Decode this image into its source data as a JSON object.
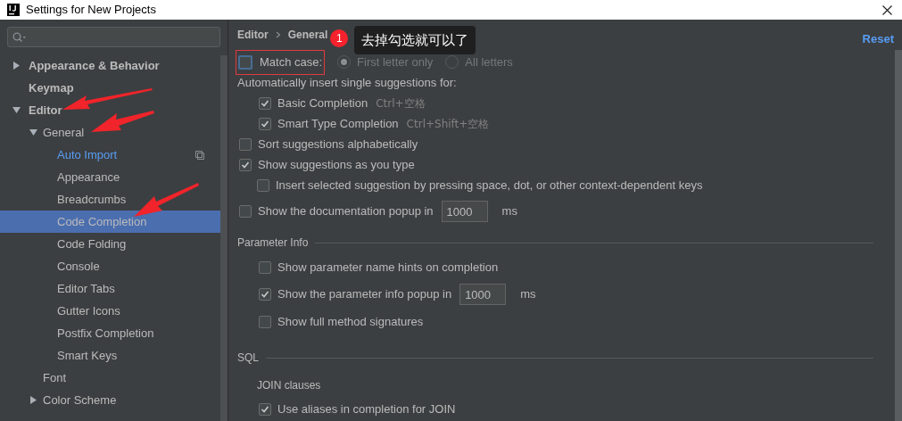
{
  "window": {
    "title": "Settings for New Projects"
  },
  "sidebar": {
    "tree": [
      {
        "label": "Appearance & Behavior",
        "expanded": false,
        "selected": false
      },
      {
        "label": "Keymap",
        "selected": false
      },
      {
        "label": "Editor",
        "expanded": true,
        "selected": false,
        "children": [
          {
            "label": "General",
            "expanded": true,
            "selected": false,
            "children": [
              {
                "label": "Auto Import",
                "selected": false,
                "modified": true,
                "project_level": true
              },
              {
                "label": "Appearance",
                "selected": false
              },
              {
                "label": "Breadcrumbs",
                "selected": false
              },
              {
                "label": "Code Completion",
                "selected": true
              },
              {
                "label": "Code Folding",
                "selected": false
              },
              {
                "label": "Console",
                "selected": false
              },
              {
                "label": "Editor Tabs",
                "selected": false
              },
              {
                "label": "Gutter Icons",
                "selected": false
              },
              {
                "label": "Postfix Completion",
                "selected": false
              },
              {
                "label": "Smart Keys",
                "selected": false
              }
            ]
          },
          {
            "label": "Font",
            "selected": false
          },
          {
            "label": "Color Scheme",
            "expanded": false,
            "selected": false
          }
        ]
      }
    ]
  },
  "breadcrumb": [
    "Editor",
    "General"
  ],
  "reset": "Reset",
  "settings": [
    {
      "kind": "match",
      "label": "Match case:",
      "checked": false,
      "highlighted": true,
      "options_disabled": true,
      "options": [
        {
          "label": "First letter only",
          "selected": true
        },
        {
          "label": "All letters",
          "selected": false
        }
      ]
    },
    {
      "kind": "heading",
      "label": "Automatically insert single suggestions for:",
      "children": [
        {
          "kind": "checkbox",
          "label": "Basic Completion",
          "checked": true,
          "shortcut": "Ctrl+空格"
        },
        {
          "kind": "checkbox",
          "label": "Smart Type Completion",
          "checked": true,
          "shortcut": "Ctrl+Shift+空格"
        }
      ]
    },
    {
      "kind": "checkbox",
      "label": "Sort suggestions alphabetically",
      "checked": false
    },
    {
      "kind": "checkbox",
      "label": "Show suggestions as you type",
      "checked": true,
      "children": [
        {
          "kind": "checkbox",
          "label": "Insert selected suggestion by pressing space, dot, or other context-dependent keys",
          "checked": false
        }
      ]
    },
    {
      "kind": "checkbox",
      "label": "Show the documentation popup in",
      "checked": false,
      "value": "1000",
      "unit": "ms"
    },
    {
      "kind": "section",
      "label": "Parameter Info",
      "children": [
        {
          "kind": "checkbox",
          "label": "Show parameter name hints on completion",
          "checked": false
        },
        {
          "kind": "checkbox",
          "label": "Show the parameter info popup in",
          "checked": true,
          "value": "1000",
          "unit": "ms"
        },
        {
          "kind": "checkbox",
          "label": "Show full method signatures",
          "checked": false
        }
      ]
    },
    {
      "kind": "section",
      "label": "SQL",
      "children": [
        {
          "kind": "subheading",
          "label": "JOIN clauses"
        },
        {
          "kind": "checkbox",
          "label": "Use aliases in completion for JOIN",
          "checked": true
        }
      ]
    }
  ],
  "annotation": {
    "badge": "1",
    "note": "去掉勾选就可以了"
  }
}
